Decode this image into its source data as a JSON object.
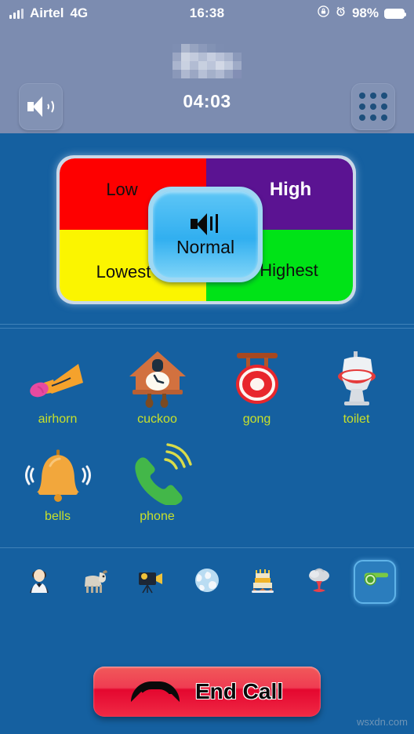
{
  "status_bar": {
    "carrier": "Airtel",
    "network": "4G",
    "time": "16:38",
    "battery_percent": "98%",
    "signal_icon": "signal-bars-icon",
    "rotation_lock_icon": "rotation-lock-icon",
    "alarm_icon": "alarm-clock-icon",
    "battery_icon": "battery-icon"
  },
  "call_header": {
    "speaker_button": "speaker-button",
    "keypad_button": "keypad-button",
    "contact_name": "",
    "duration": "04:03"
  },
  "volume_panel": {
    "quadrants": [
      {
        "label": "Low",
        "color": "#fe0000",
        "key": "low"
      },
      {
        "label": "High",
        "color": "#5b1392",
        "key": "high"
      },
      {
        "label": "Lowest",
        "color": "#fbf500",
        "key": "lowest"
      },
      {
        "label": "Highest",
        "color": "#00e317",
        "key": "highest"
      }
    ],
    "center_button": {
      "label": "Normal",
      "icon": "speaker-icon",
      "color": "#31aff0"
    }
  },
  "sounds": [
    {
      "label": "airhorn",
      "icon": "airhorn-icon"
    },
    {
      "label": "cuckoo",
      "icon": "cuckoo-clock-icon"
    },
    {
      "label": "gong",
      "icon": "gong-icon"
    },
    {
      "label": "toilet",
      "icon": "toilet-icon"
    },
    {
      "label": "bells",
      "icon": "bell-icon"
    },
    {
      "label": "phone",
      "icon": "ringing-phone-icon"
    }
  ],
  "category_tabs": [
    {
      "icon": "person-icon",
      "selected": false
    },
    {
      "icon": "goat-icon",
      "selected": false
    },
    {
      "icon": "movie-camera-icon",
      "selected": false
    },
    {
      "icon": "globe-icon",
      "selected": false
    },
    {
      "icon": "birthday-cake-icon",
      "selected": false
    },
    {
      "icon": "explosion-icon",
      "selected": false
    },
    {
      "icon": "whistle-icon",
      "selected": true
    }
  ],
  "end_call": {
    "label": "End Call",
    "icon": "handset-icon",
    "color": "#e4072f"
  },
  "watermark": "wsxdn.com",
  "theme": {
    "header_bg": "#7c8cb0",
    "body_bg": "#1560a0",
    "label_color": "#c8e02a"
  }
}
